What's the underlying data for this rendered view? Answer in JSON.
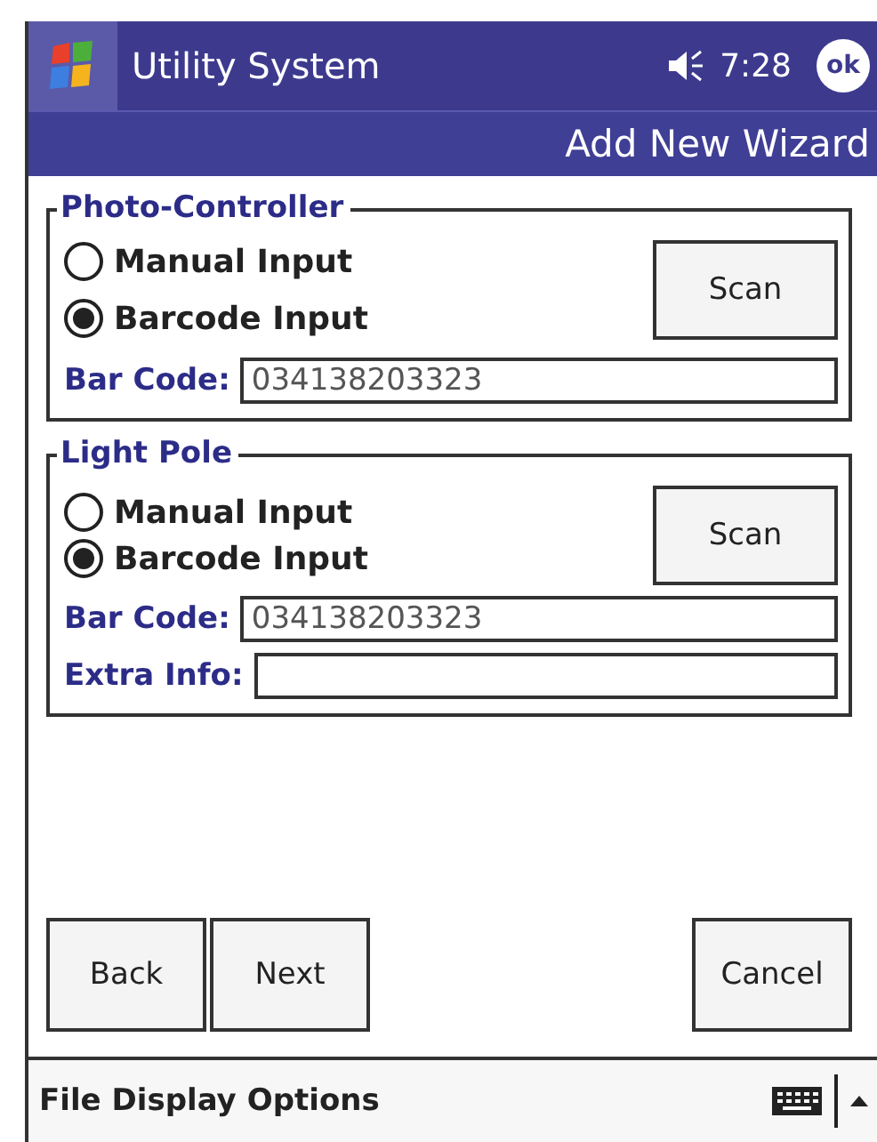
{
  "title_bar": {
    "title": "Utility System",
    "time": "7:28",
    "ok": "ok"
  },
  "header": {
    "title": "Add New Wizard"
  },
  "groups": [
    {
      "title": "Photo-Controller",
      "options": [
        {
          "label": "Manual Input",
          "selected": false
        },
        {
          "label": "Barcode Input",
          "selected": true
        }
      ],
      "scan": "Scan",
      "fields": [
        {
          "label": "Bar Code:",
          "value": "034138203323"
        }
      ]
    },
    {
      "title": "Light Pole",
      "options": [
        {
          "label": "Manual Input",
          "selected": false
        },
        {
          "label": "Barcode Input",
          "selected": true
        }
      ],
      "scan": "Scan",
      "fields": [
        {
          "label": "Bar Code:",
          "value": "034138203323"
        },
        {
          "label": "Extra Info:"
        }
      ]
    }
  ],
  "buttons": [
    "Back",
    "Next"
  ],
  "cancel": "Cancel",
  "menu": [
    "File",
    "Display",
    "Options"
  ]
}
